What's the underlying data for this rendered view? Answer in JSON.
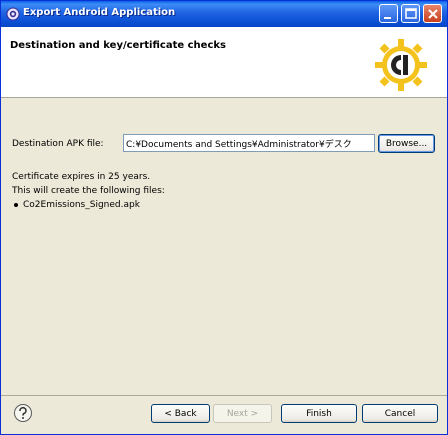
{
  "window": {
    "title": "Export Android Application",
    "colors": {
      "titlebar": "#0a5fe8",
      "face": "#ece9d8",
      "banner": "#ffffff",
      "logo_yellow": "#f2c21e"
    }
  },
  "banner": {
    "heading": "Destination and key/certificate checks",
    "logo_icon": "android-tools-logo-icon"
  },
  "form": {
    "destination_label": "Destination APK file:",
    "destination_value": "C:¥Documents and Settings¥Administrator¥デスク",
    "browse_label": "Browse..."
  },
  "info": {
    "expiry": "Certificate expires in 25 years.",
    "files_intro": "This will create the following files:",
    "files": [
      "Co2Emissions_Signed.apk"
    ]
  },
  "footer": {
    "back_label": "< Back",
    "next_label": "Next >",
    "finish_label": "Finish",
    "cancel_label": "Cancel",
    "help_icon": "help-icon"
  }
}
